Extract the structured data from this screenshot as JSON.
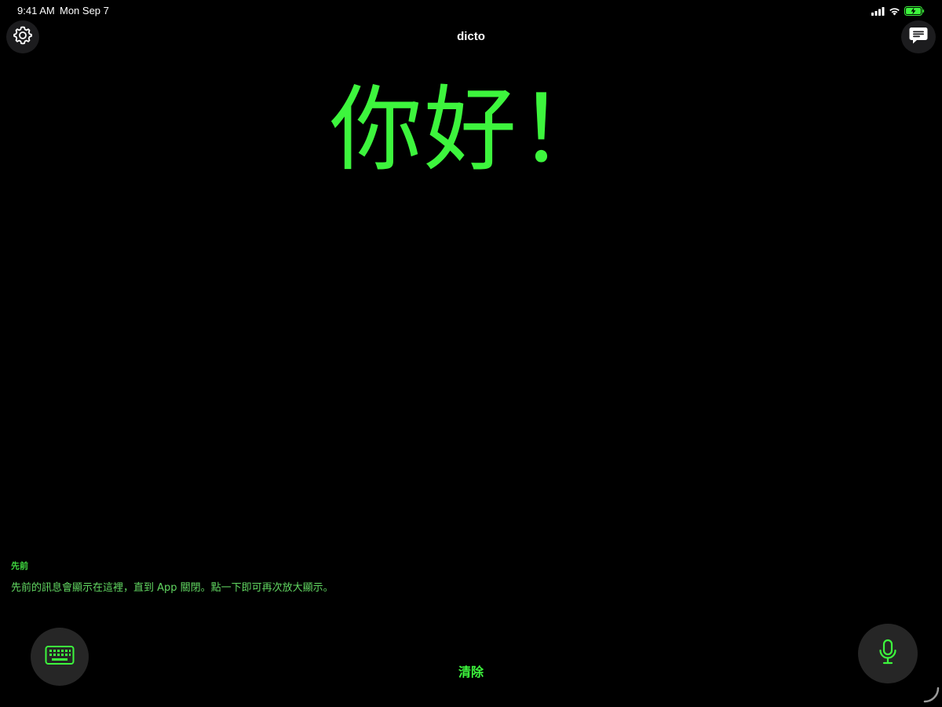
{
  "status_bar": {
    "time": "9:41 AM",
    "date": "Mon Sep 7",
    "icons": [
      "signal-icon",
      "wifi-icon",
      "battery-charging-icon"
    ]
  },
  "header": {
    "title": "dicto",
    "left_icon": "gear-icon",
    "right_icon": "message-bubble-icon"
  },
  "main": {
    "message": "你好！"
  },
  "history": {
    "heading": "先前",
    "hint": "先前的訊息會顯示在這裡，直到 App 關閉。點一下即可再次放大顯示。"
  },
  "bottom_bar": {
    "keyboard_icon": "keyboard-icon",
    "clear_label": "清除",
    "mic_icon": "microphone-icon"
  },
  "colors": {
    "background": "#000000",
    "accent": "#3df53d",
    "button_bg": "#262626"
  }
}
